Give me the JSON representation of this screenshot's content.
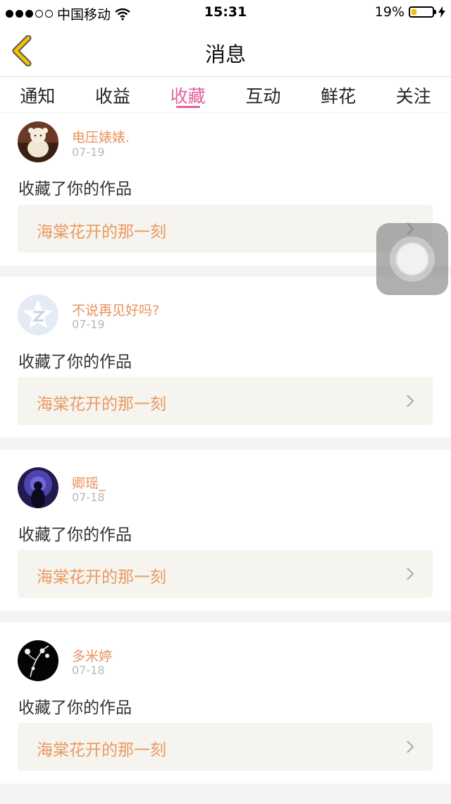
{
  "status_bar": {
    "carrier": "中国移动",
    "time": "15:31",
    "battery_text": "19%",
    "signal_filled": 3,
    "signal_total": 5
  },
  "nav": {
    "title": "消息"
  },
  "tabs": [
    {
      "label": "通知",
      "active": false
    },
    {
      "label": "收益",
      "active": false
    },
    {
      "label": "收藏",
      "active": true
    },
    {
      "label": "互动",
      "active": false
    },
    {
      "label": "鲜花",
      "active": false
    },
    {
      "label": "关注",
      "active": false
    }
  ],
  "items": [
    {
      "username": "电压婊婊.",
      "date": "07-19",
      "action": "收藏了你的作品",
      "work_title": "海棠花开的那一刻",
      "avatar": "cartoon-doll-avatar"
    },
    {
      "username": "不说再见好吗?",
      "date": "07-19",
      "action": "收藏了你的作品",
      "work_title": "海棠花开的那一刻",
      "avatar": "default-qzone-avatar"
    },
    {
      "username": "卿瑶_",
      "date": "07-18",
      "action": "收藏了你的作品",
      "work_title": "海棠花开的那一刻",
      "avatar": "purple-silhouette-avatar"
    },
    {
      "username": "多米婷",
      "date": "07-18",
      "action": "收藏了你的作品",
      "work_title": "海棠花开的那一刻",
      "avatar": "black-flower-avatar"
    }
  ],
  "colors": {
    "accent": "#e3629b",
    "username": "#e8935c",
    "work_title": "#ea9a60",
    "back_arrow": "#f2c200"
  }
}
